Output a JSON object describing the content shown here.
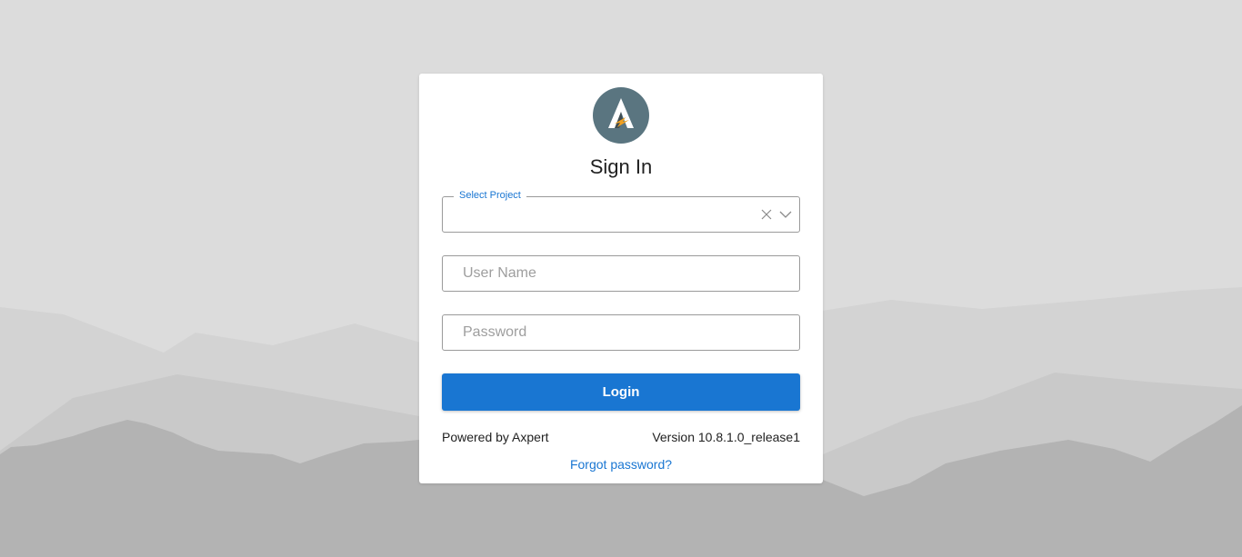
{
  "card": {
    "title": "Sign In"
  },
  "project_select": {
    "label": "Select Project",
    "value": ""
  },
  "username": {
    "placeholder": "User Name",
    "value": ""
  },
  "password": {
    "placeholder": "Password",
    "value": ""
  },
  "login_button": {
    "label": "Login"
  },
  "footer": {
    "powered_by": "Powered by Axpert",
    "version": "Version 10.8.1.0_release1",
    "forgot_password": "Forgot password?"
  },
  "colors": {
    "accent": "#1976d2",
    "background": "#dcdcdc",
    "logo_circle": "#5a7580"
  },
  "icons": {
    "logo": "axpert-logo-icon",
    "clear": "clear-icon",
    "dropdown": "chevron-down-icon"
  }
}
